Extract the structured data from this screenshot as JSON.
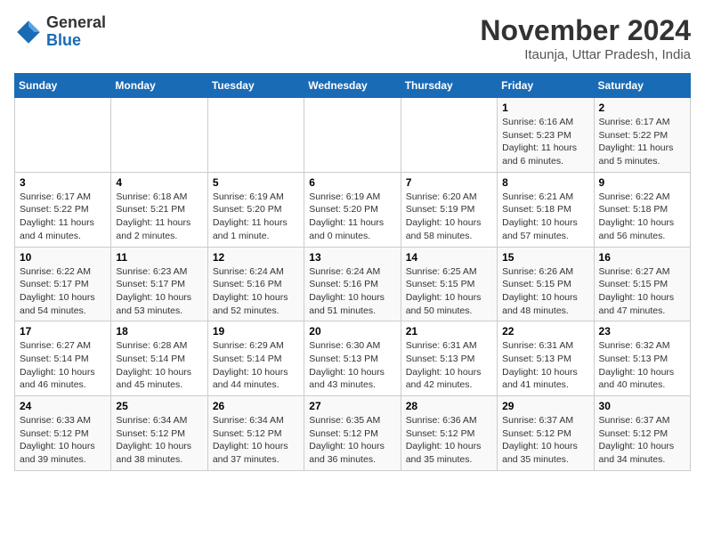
{
  "header": {
    "logo_general": "General",
    "logo_blue": "Blue",
    "month_title": "November 2024",
    "subtitle": "Itaunja, Uttar Pradesh, India"
  },
  "calendar": {
    "days_of_week": [
      "Sunday",
      "Monday",
      "Tuesday",
      "Wednesday",
      "Thursday",
      "Friday",
      "Saturday"
    ],
    "weeks": [
      [
        {
          "day": "",
          "info": ""
        },
        {
          "day": "",
          "info": ""
        },
        {
          "day": "",
          "info": ""
        },
        {
          "day": "",
          "info": ""
        },
        {
          "day": "",
          "info": ""
        },
        {
          "day": "1",
          "info": "Sunrise: 6:16 AM\nSunset: 5:23 PM\nDaylight: 11 hours and 6 minutes."
        },
        {
          "day": "2",
          "info": "Sunrise: 6:17 AM\nSunset: 5:22 PM\nDaylight: 11 hours and 5 minutes."
        }
      ],
      [
        {
          "day": "3",
          "info": "Sunrise: 6:17 AM\nSunset: 5:22 PM\nDaylight: 11 hours and 4 minutes."
        },
        {
          "day": "4",
          "info": "Sunrise: 6:18 AM\nSunset: 5:21 PM\nDaylight: 11 hours and 2 minutes."
        },
        {
          "day": "5",
          "info": "Sunrise: 6:19 AM\nSunset: 5:20 PM\nDaylight: 11 hours and 1 minute."
        },
        {
          "day": "6",
          "info": "Sunrise: 6:19 AM\nSunset: 5:20 PM\nDaylight: 11 hours and 0 minutes."
        },
        {
          "day": "7",
          "info": "Sunrise: 6:20 AM\nSunset: 5:19 PM\nDaylight: 10 hours and 58 minutes."
        },
        {
          "day": "8",
          "info": "Sunrise: 6:21 AM\nSunset: 5:18 PM\nDaylight: 10 hours and 57 minutes."
        },
        {
          "day": "9",
          "info": "Sunrise: 6:22 AM\nSunset: 5:18 PM\nDaylight: 10 hours and 56 minutes."
        }
      ],
      [
        {
          "day": "10",
          "info": "Sunrise: 6:22 AM\nSunset: 5:17 PM\nDaylight: 10 hours and 54 minutes."
        },
        {
          "day": "11",
          "info": "Sunrise: 6:23 AM\nSunset: 5:17 PM\nDaylight: 10 hours and 53 minutes."
        },
        {
          "day": "12",
          "info": "Sunrise: 6:24 AM\nSunset: 5:16 PM\nDaylight: 10 hours and 52 minutes."
        },
        {
          "day": "13",
          "info": "Sunrise: 6:24 AM\nSunset: 5:16 PM\nDaylight: 10 hours and 51 minutes."
        },
        {
          "day": "14",
          "info": "Sunrise: 6:25 AM\nSunset: 5:15 PM\nDaylight: 10 hours and 50 minutes."
        },
        {
          "day": "15",
          "info": "Sunrise: 6:26 AM\nSunset: 5:15 PM\nDaylight: 10 hours and 48 minutes."
        },
        {
          "day": "16",
          "info": "Sunrise: 6:27 AM\nSunset: 5:15 PM\nDaylight: 10 hours and 47 minutes."
        }
      ],
      [
        {
          "day": "17",
          "info": "Sunrise: 6:27 AM\nSunset: 5:14 PM\nDaylight: 10 hours and 46 minutes."
        },
        {
          "day": "18",
          "info": "Sunrise: 6:28 AM\nSunset: 5:14 PM\nDaylight: 10 hours and 45 minutes."
        },
        {
          "day": "19",
          "info": "Sunrise: 6:29 AM\nSunset: 5:14 PM\nDaylight: 10 hours and 44 minutes."
        },
        {
          "day": "20",
          "info": "Sunrise: 6:30 AM\nSunset: 5:13 PM\nDaylight: 10 hours and 43 minutes."
        },
        {
          "day": "21",
          "info": "Sunrise: 6:31 AM\nSunset: 5:13 PM\nDaylight: 10 hours and 42 minutes."
        },
        {
          "day": "22",
          "info": "Sunrise: 6:31 AM\nSunset: 5:13 PM\nDaylight: 10 hours and 41 minutes."
        },
        {
          "day": "23",
          "info": "Sunrise: 6:32 AM\nSunset: 5:13 PM\nDaylight: 10 hours and 40 minutes."
        }
      ],
      [
        {
          "day": "24",
          "info": "Sunrise: 6:33 AM\nSunset: 5:12 PM\nDaylight: 10 hours and 39 minutes."
        },
        {
          "day": "25",
          "info": "Sunrise: 6:34 AM\nSunset: 5:12 PM\nDaylight: 10 hours and 38 minutes."
        },
        {
          "day": "26",
          "info": "Sunrise: 6:34 AM\nSunset: 5:12 PM\nDaylight: 10 hours and 37 minutes."
        },
        {
          "day": "27",
          "info": "Sunrise: 6:35 AM\nSunset: 5:12 PM\nDaylight: 10 hours and 36 minutes."
        },
        {
          "day": "28",
          "info": "Sunrise: 6:36 AM\nSunset: 5:12 PM\nDaylight: 10 hours and 35 minutes."
        },
        {
          "day": "29",
          "info": "Sunrise: 6:37 AM\nSunset: 5:12 PM\nDaylight: 10 hours and 35 minutes."
        },
        {
          "day": "30",
          "info": "Sunrise: 6:37 AM\nSunset: 5:12 PM\nDaylight: 10 hours and 34 minutes."
        }
      ]
    ]
  }
}
